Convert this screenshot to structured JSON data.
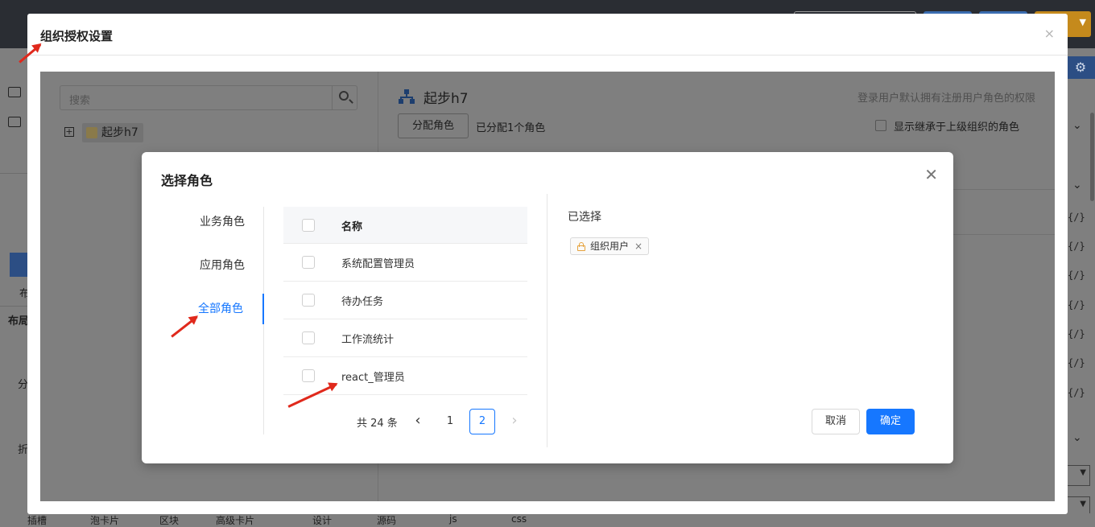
{
  "outer_dialog": {
    "title": "组织授权设置",
    "close": "×",
    "search_placeholder": "搜索",
    "tree": {
      "expander": "+",
      "node_label": "起步h7"
    },
    "org_title": "起步h7",
    "hint": "登录用户默认拥有注册用户角色的权限",
    "assign_button": "分配角色",
    "assigned_count": "已分配1个角色",
    "inherit_label": "显示继承于上级组织的角色"
  },
  "role_dialog": {
    "title": "选择角色",
    "close": "✕",
    "categories": [
      {
        "label": "业务角色",
        "active": false
      },
      {
        "label": "应用角色",
        "active": false
      },
      {
        "label": "全部角色",
        "active": true
      }
    ],
    "table": {
      "header": "名称",
      "rows": [
        "系统配置管理员",
        "待办任务",
        "工作流统计",
        "react_管理员"
      ]
    },
    "pagination": {
      "total": "共 24 条",
      "prev": "‹",
      "pages": [
        "1",
        "2"
      ],
      "current": "2",
      "next": "›"
    },
    "selected": {
      "title": "已选择",
      "tags": [
        "组织用户"
      ],
      "tag_remove": "×"
    },
    "cancel": "取消",
    "confirm": "确定"
  },
  "background": {
    "right_tags": [
      "{/}",
      "{/}",
      "{/}",
      "{/}",
      "{/}",
      "{/}",
      "{/}"
    ],
    "left_labels": [
      "布",
      "布局",
      "分",
      "折"
    ],
    "bottom_labels": [
      "插槽",
      "泡卡片",
      "区块",
      "高级卡片",
      "设计",
      "源码",
      "js",
      "css"
    ]
  },
  "colors": {
    "primary": "#1677ff",
    "lock": "#e6a23c",
    "annotation": "#e0291c"
  }
}
